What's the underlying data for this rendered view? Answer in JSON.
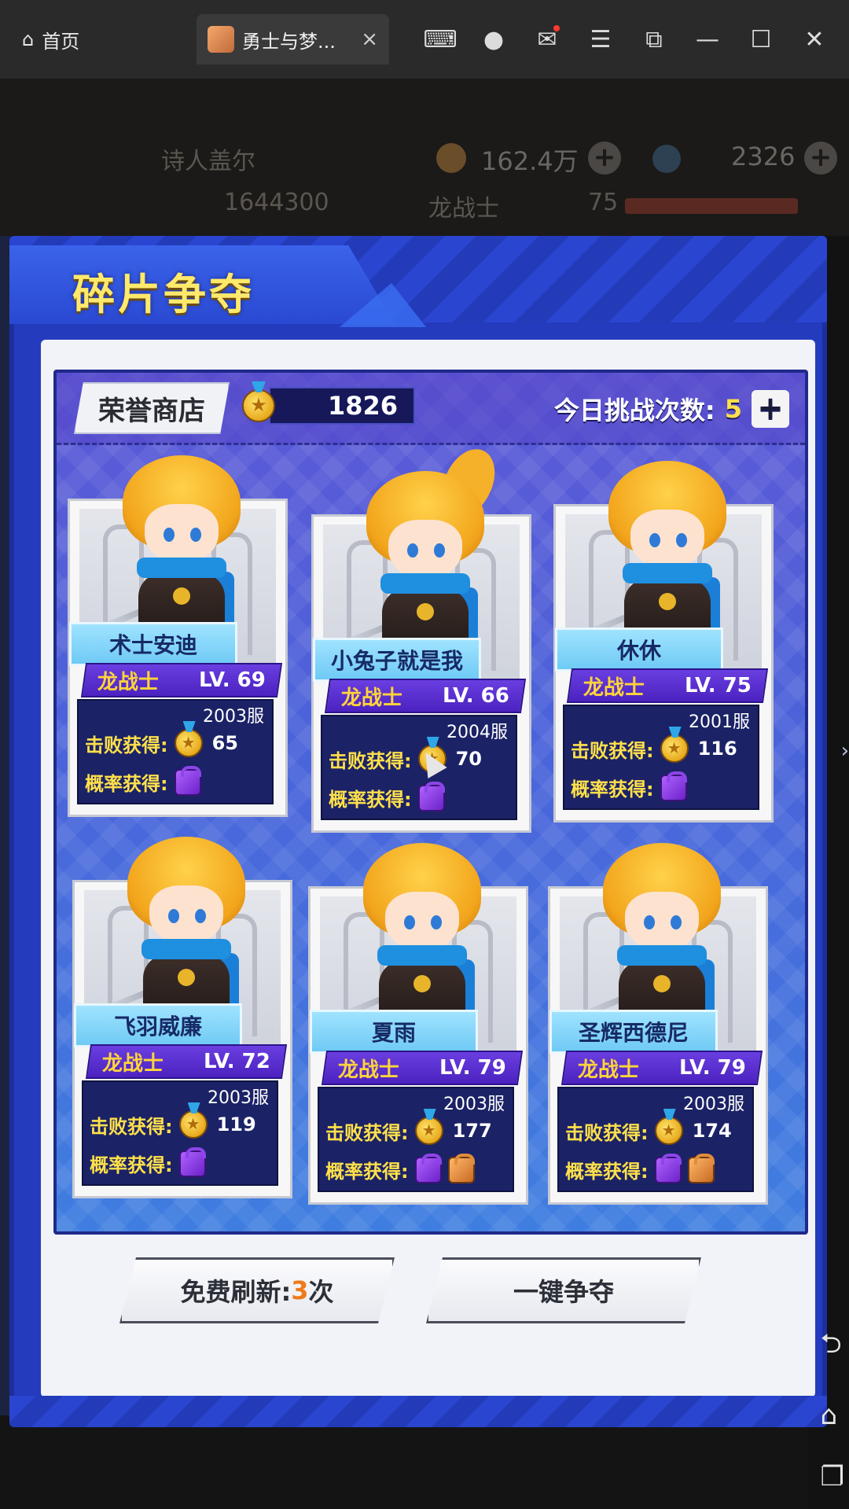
{
  "window": {
    "home_label": "首页",
    "tab_title": "勇士与梦...",
    "tab_close": "×",
    "icons": [
      "gamepad-icon",
      "avatar-icon",
      "mail-icon",
      "menu-icon",
      "screenshot-icon",
      "minimize-icon",
      "maximize-icon",
      "close-icon"
    ]
  },
  "hud": {
    "player_name": "诗人盖尔",
    "power": "1644300",
    "job": "龙战士",
    "level": "75",
    "gold": "162.4万",
    "gems": "2326"
  },
  "panel": {
    "title": "碎片争夺",
    "shop_label": "荣誉商店",
    "honor_points": "1826",
    "challenge_label": "今日挑战次数:",
    "challenge_count": "5",
    "plus": "+",
    "defeat_label": "击败获得:",
    "chance_label": "概率获得:"
  },
  "opponents": [
    {
      "name": "术士安迪",
      "class": "龙战士",
      "level": "LV. 69",
      "server": "2003服",
      "reward": "65",
      "drops": [
        "purple-fragment"
      ]
    },
    {
      "name": "小兔子就是我",
      "class": "龙战士",
      "level": "LV. 66",
      "server": "2004服",
      "reward": "70",
      "drops": [
        "purple-fragment"
      ]
    },
    {
      "name": "休休",
      "class": "龙战士",
      "level": "LV. 75",
      "server": "2001服",
      "reward": "116",
      "drops": [
        "purple-fragment"
      ]
    },
    {
      "name": "飞羽威廉",
      "class": "龙战士",
      "level": "LV. 72",
      "server": "2003服",
      "reward": "119",
      "drops": [
        "purple-fragment"
      ]
    },
    {
      "name": "夏雨",
      "class": "龙战士",
      "level": "LV. 79",
      "server": "2003服",
      "reward": "177",
      "drops": [
        "purple-fragment",
        "orange-fragment"
      ]
    },
    {
      "name": "圣辉西德尼",
      "class": "龙战士",
      "level": "LV. 79",
      "server": "2003服",
      "reward": "174",
      "drops": [
        "purple-fragment",
        "orange-fragment"
      ]
    }
  ],
  "buttons": {
    "refresh_prefix": "免费刷新:",
    "refresh_count": "3",
    "refresh_suffix": "次",
    "grab_all": "一键争夺"
  },
  "side_buttons": {
    "back": "⮌",
    "home": "⌂",
    "recent": "❐"
  },
  "colors": {
    "panel_blue": "#243bbd",
    "title_yellow": "#ffe96b",
    "class_purple": "#5a2fd6",
    "highlight_orange": "#ef7a1a"
  }
}
